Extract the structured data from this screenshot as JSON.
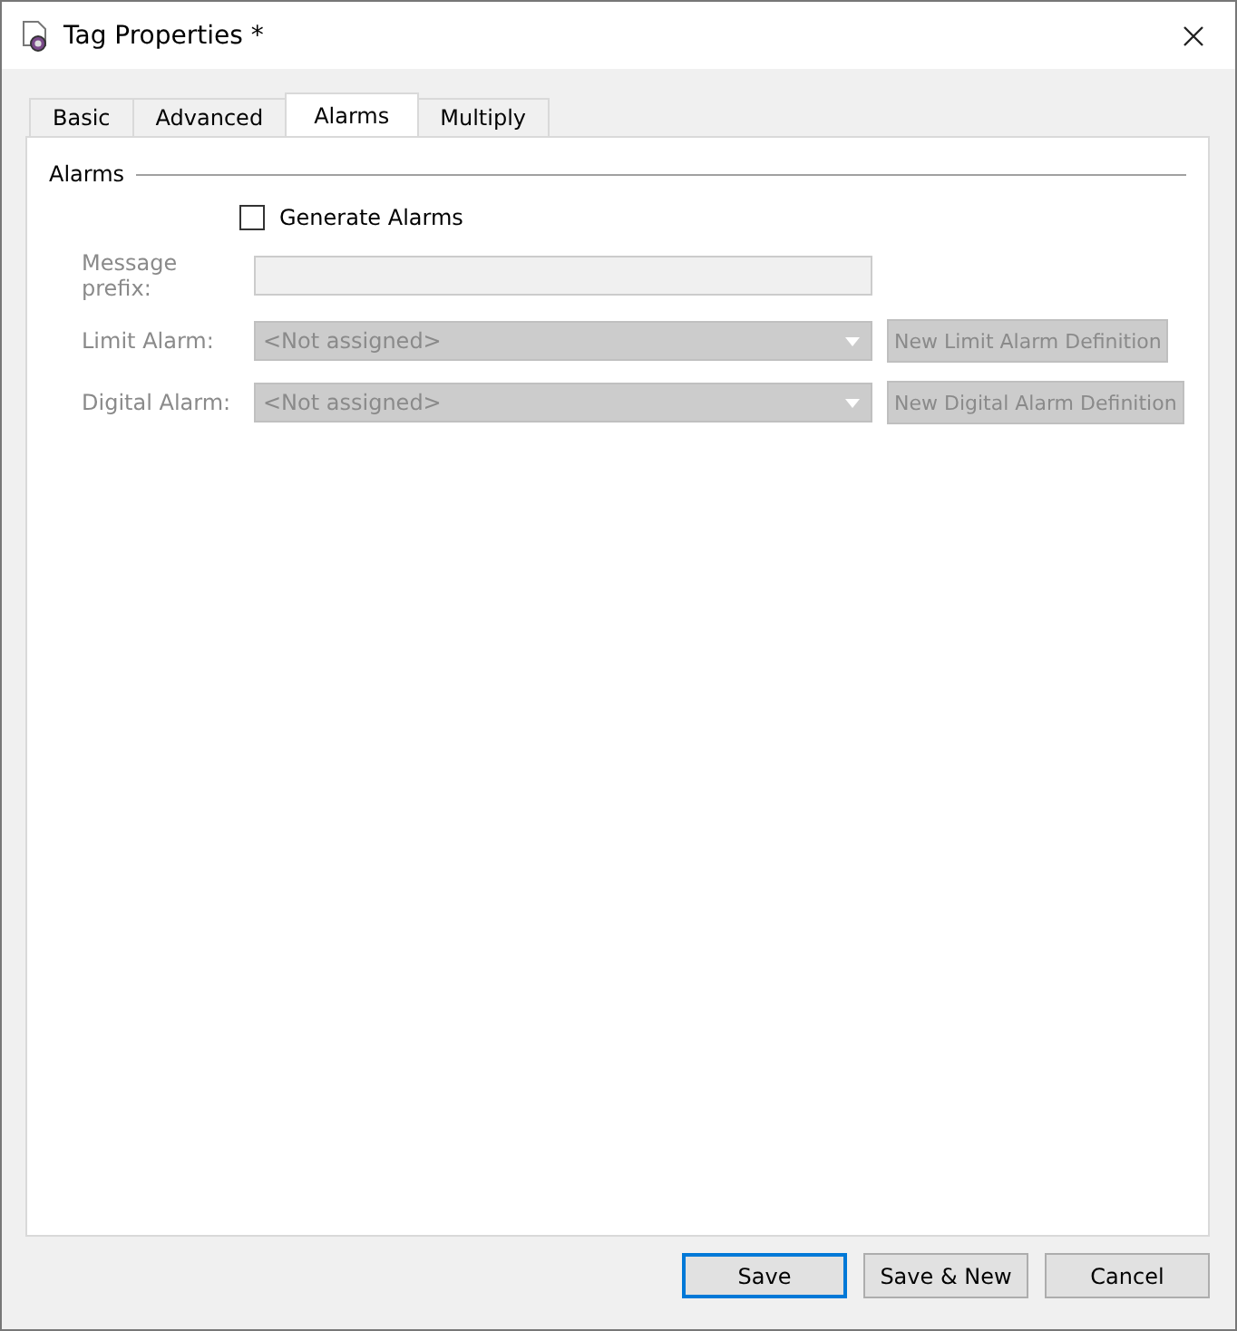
{
  "window": {
    "title": "Tag Properties *"
  },
  "tabs": [
    {
      "label": "Basic",
      "selected": false
    },
    {
      "label": "Advanced",
      "selected": false
    },
    {
      "label": "Alarms",
      "selected": true
    },
    {
      "label": "Multiply",
      "selected": false
    }
  ],
  "group": {
    "title": "Alarms"
  },
  "generate_alarms": {
    "label": "Generate Alarms",
    "checked": false
  },
  "rows": [
    {
      "kind": "text",
      "label": "Message prefix:",
      "disabled": true
    },
    {
      "kind": "dropdown",
      "label": "Limit Alarm:",
      "value": "<Not assigned>",
      "disabled": true,
      "button": "New Limit Alarm Definition"
    },
    {
      "kind": "dropdown",
      "label": "Digital Alarm:",
      "value": "<Not assigned>",
      "disabled": true,
      "button": "New Digital Alarm Definition"
    }
  ],
  "buttons": [
    {
      "label": "Save",
      "default": true
    },
    {
      "label": "Save & New",
      "default": false
    },
    {
      "label": "Cancel",
      "default": false
    }
  ]
}
